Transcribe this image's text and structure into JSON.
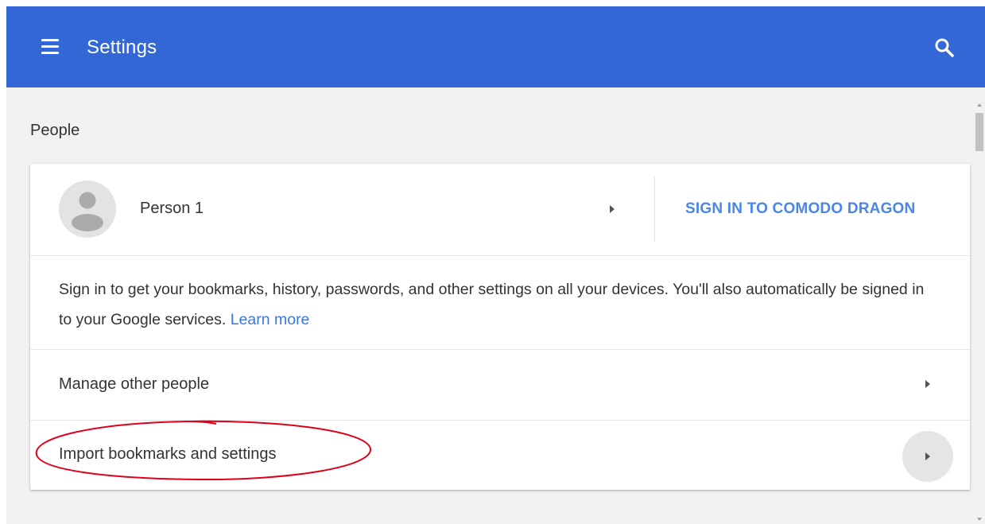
{
  "header": {
    "title": "Settings",
    "menu_icon": "hamburger-menu-icon",
    "search_icon": "search-icon",
    "background_color": "#3367d6"
  },
  "people": {
    "section_title": "People",
    "profile": {
      "name": "Person 1",
      "avatar_icon": "person-avatar-icon",
      "arrow_icon": "chevron-right-icon",
      "sign_in_label": "SIGN IN TO COMODO DRAGON"
    },
    "description": {
      "text": "Sign in to get your bookmarks, history, passwords, and other settings on all your devices. You'll also automatically be signed in to your Google services.",
      "link": "Learn more"
    },
    "rows": [
      {
        "label": "Manage other people",
        "icon": "chevron-right-icon"
      },
      {
        "label": "Import bookmarks and settings",
        "icon": "chevron-right-icon",
        "annotated": true
      }
    ]
  },
  "colors": {
    "accent": "#4a86e8",
    "link": "#3a78e0",
    "annotation": "#e0001b",
    "page_background": "#f1f1f1"
  }
}
